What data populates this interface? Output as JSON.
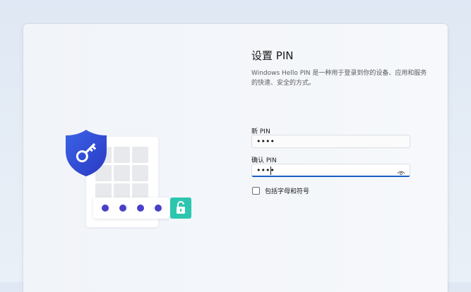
{
  "setup": {
    "title": "设置 PIN",
    "description": "Windows Hello PIN 是一种用于登录到你的设备、应用和服务的快速、安全的方式。",
    "new_pin_label": "新 PIN",
    "new_pin_value": "••••",
    "confirm_pin_label": "确认 PIN",
    "confirm_pin_value": "••••",
    "include_letters_label": "包括字母和符号",
    "include_letters_checked": false
  },
  "illustration": {
    "shield_color": "#2d4fd9",
    "key_icon": "key-icon",
    "lock_icon": "unlocked-padlock-icon",
    "lock_tile_color": "#2cc6ae",
    "pin_dot_color": "#4a3fc9"
  }
}
